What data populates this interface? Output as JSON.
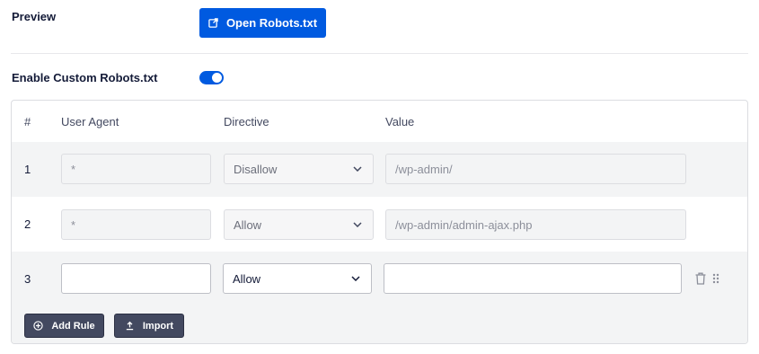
{
  "preview": {
    "label": "Preview",
    "open_button_label": "Open Robots.txt",
    "open_icon": "external-link-icon"
  },
  "custom_robots": {
    "label": "Enable Custom Robots.txt",
    "enabled": true
  },
  "rules_table": {
    "columns": [
      "#",
      "User Agent",
      "Directive",
      "Value"
    ],
    "rows": [
      {
        "num": "1",
        "user_agent": "*",
        "directive": "Disallow",
        "value": "/wp-admin/",
        "editable": false
      },
      {
        "num": "2",
        "user_agent": "*",
        "directive": "Allow",
        "value": "/wp-admin/admin-ajax.php",
        "editable": false
      },
      {
        "num": "3",
        "user_agent": "",
        "directive": "Allow",
        "value": "",
        "editable": true
      }
    ],
    "row_actions": {
      "delete_icon": "trash-icon",
      "drag_icon": "drag-handle-icon"
    }
  },
  "footer": {
    "add_rule_label": "Add Rule",
    "add_rule_icon": "plus-circle-icon",
    "import_label": "Import",
    "import_icon": "upload-icon"
  },
  "colors": {
    "accent": "#005ae0",
    "footer_button": "#434960"
  }
}
